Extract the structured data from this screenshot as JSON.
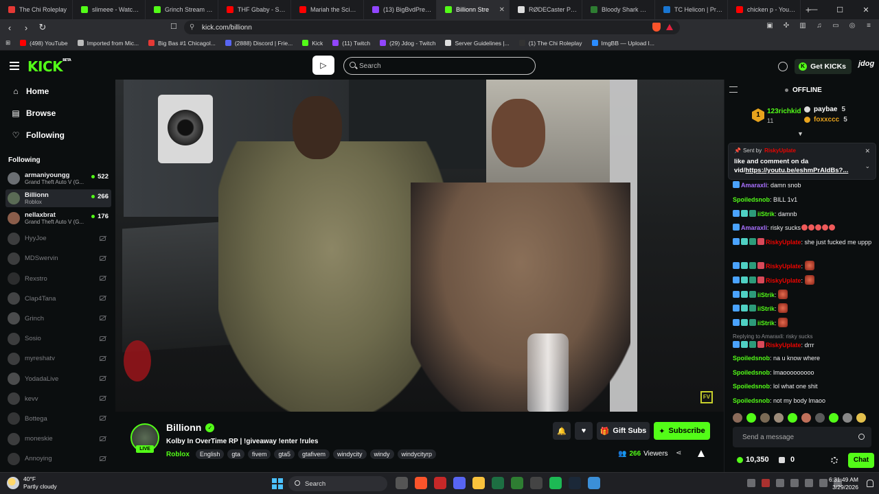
{
  "browser": {
    "tabs": [
      {
        "title": "The Chi Roleplay",
        "color": "#e53935"
      },
      {
        "title": "slimeee - Watch clip",
        "color": "#53fc18"
      },
      {
        "title": "Grinch Stream - Wa",
        "color": "#53fc18"
      },
      {
        "title": "THF Gbaby - SCOO",
        "color": "#ff0000"
      },
      {
        "title": "Mariah the Scientist",
        "color": "#ff0000"
      },
      {
        "title": "(13) BigBvdPretty -",
        "color": "#9146ff"
      },
      {
        "title": "Billionn Stre",
        "color": "#53fc18",
        "active": true
      },
      {
        "title": "RØDECaster Pro | P",
        "color": "#dddddd"
      },
      {
        "title": "Bloody Shark Crazy",
        "color": "#2e7d32"
      },
      {
        "title": "TC Helicon | Produc",
        "color": "#1976d2"
      },
      {
        "title": "chicken p - YouTub",
        "color": "#ff0000"
      }
    ],
    "new_tab": "+",
    "url": "kick.com/billionn",
    "bookmarks": [
      {
        "label": "(498) YouTube",
        "color": "#ff0000"
      },
      {
        "label": "Imported from Mic...",
        "color": "#bbbbbb"
      },
      {
        "label": "Big Bas #1 Chicagol...",
        "color": "#e53935"
      },
      {
        "label": "(2888) Discord | Frie...",
        "color": "#5865f2"
      },
      {
        "label": "Kick",
        "color": "#53fc18"
      },
      {
        "label": "(11) Twitch",
        "color": "#9146ff"
      },
      {
        "label": "(29) Jdog - Twitch",
        "color": "#9146ff"
      },
      {
        "label": "Server Guidelines |...",
        "color": "#dddddd"
      },
      {
        "label": "(1) The Chi Roleplay",
        "color": "#333333"
      },
      {
        "label": "ImgBB — Upload I...",
        "color": "#2b8cff"
      }
    ]
  },
  "header": {
    "logo": "KICK",
    "logo_sup": "BETA",
    "search_placeholder": "Search",
    "get_kicks": "Get KICKs",
    "user": "jdog"
  },
  "sidebar": {
    "nav": [
      {
        "label": "Home",
        "icon": "⌂"
      },
      {
        "label": "Browse",
        "icon": "▤"
      },
      {
        "label": "Following",
        "icon": "♡"
      }
    ],
    "following_title": "Following",
    "channels": [
      {
        "name": "armaniyoungg",
        "game": "Grand Theft Auto V (G...",
        "viewers": "522",
        "live": true,
        "color": "#6b6f73"
      },
      {
        "name": "Billionn",
        "game": "Roblox",
        "viewers": "266",
        "live": true,
        "selected": true,
        "color": "#5a6b55"
      },
      {
        "name": "nellaxbrat",
        "game": "Grand Theft Auto V (G...",
        "viewers": "176",
        "live": true,
        "color": "#8a5d4a"
      },
      {
        "name": "HyyJoe",
        "live": false,
        "color": "#777"
      },
      {
        "name": "MDSwervin",
        "live": false,
        "color": "#777"
      },
      {
        "name": "Rexstro",
        "live": false,
        "color": "#555"
      },
      {
        "name": "Clap4Tana",
        "live": false,
        "color": "#888"
      },
      {
        "name": "Grinch",
        "live": false,
        "color": "#999"
      },
      {
        "name": "Sosio",
        "live": false,
        "color": "#777"
      },
      {
        "name": "myreshatv",
        "live": false,
        "color": "#777"
      },
      {
        "name": "YodadaLive",
        "live": false,
        "color": "#999"
      },
      {
        "name": "kevv",
        "live": false,
        "color": "#777"
      },
      {
        "name": "Bottega",
        "live": false,
        "color": "#666"
      },
      {
        "name": "moneskie",
        "live": false,
        "color": "#777"
      },
      {
        "name": "Annoying",
        "live": false,
        "color": "#666"
      }
    ]
  },
  "video": {
    "watermark": "FV"
  },
  "stream": {
    "name": "Billionn",
    "live_label": "LIVE",
    "title": "Kolby In OverTime RP | !giveaway !enter !rules",
    "category": "Roblox",
    "tags": [
      "English",
      "gta",
      "fivem",
      "gta5",
      "gtafivem",
      "windycity",
      "windy",
      "windycityrp"
    ],
    "gift_subs": "Gift Subs",
    "subscribe": "Subscribe",
    "viewers_count": "266",
    "viewers_label": "Viewers"
  },
  "chat": {
    "status": "OFFLINE",
    "leaderboard": {
      "rank": "1",
      "top_user": "123richkid",
      "top_count": "11",
      "others": [
        {
          "name": "paybae",
          "count": "5",
          "color": "#dddddd"
        },
        {
          "name": "foxxccc",
          "count": "5",
          "color": "#e8a31d"
        }
      ]
    },
    "pinned": {
      "sent_by": "Sent by",
      "user": "RiskyUpIate",
      "message": "like and comment on da vid/",
      "link": "https://youtu.be/eshmPrAldBs?..."
    },
    "messages": [
      {
        "user": "Amaraxli",
        "color": "#a970ff",
        "text": ": damn snob",
        "badges": 1
      },
      {
        "user": "Spoiledsnob",
        "color": "#53fc18",
        "text": ": BILL 1v1",
        "badges": 0
      },
      {
        "user": "iiStrik",
        "color": "#53fc18",
        "text": ": damnb",
        "badges": 3
      },
      {
        "user": "Amaraxli",
        "color": "#a970ff",
        "text": ": risky sucks",
        "badges": 1,
        "smalls": 5
      },
      {
        "user": "RiskyUpIate",
        "color": "#eb0400",
        "text": ": she just fucked me uppp",
        "badges": 4
      },
      {
        "user": "RiskyUpIate",
        "color": "#eb0400",
        "text": ": ",
        "badges": 4,
        "emote": true
      },
      {
        "user": "RiskyUpIate",
        "color": "#eb0400",
        "text": ": ",
        "badges": 4,
        "emote": true
      },
      {
        "user": "iiStrik",
        "color": "#53fc18",
        "text": ": ",
        "badges": 3,
        "emote": true
      },
      {
        "user": "iiStrik",
        "color": "#53fc18",
        "text": ": ",
        "badges": 3,
        "emote": true
      },
      {
        "user": "iiStrik",
        "color": "#53fc18",
        "text": ": ",
        "badges": 3,
        "emote": true
      },
      {
        "reply": "Replying to Amaraxli: risky sucks",
        "user": "RiskyUpIate",
        "color": "#eb0400",
        "text": ": drrr",
        "badges": 4
      },
      {
        "user": "Spoiledsnob",
        "color": "#53fc18",
        "text": ": na u know where",
        "badges": 0
      },
      {
        "user": "Spoiledsnob",
        "color": "#53fc18",
        "text": ": lmaooooooooo",
        "badges": 0
      },
      {
        "user": "Spoiledsnob",
        "color": "#53fc18",
        "text": ": lol what one shit",
        "badges": 0
      },
      {
        "user": "Spoiledsnob",
        "color": "#53fc18",
        "text": ": not my body lmaoo",
        "badges": 0
      }
    ],
    "send_placeholder": "Send a message",
    "points": "10,350",
    "gifts": "0",
    "chat_button": "Chat"
  },
  "taskbar": {
    "temp": "40°F",
    "weather": "Partly cloudy",
    "search": "Search",
    "time": "6:31:49 AM",
    "date": "3/29/2026"
  },
  "colors": {
    "accent": "#53fc18",
    "bg": "#0b0e0f"
  }
}
